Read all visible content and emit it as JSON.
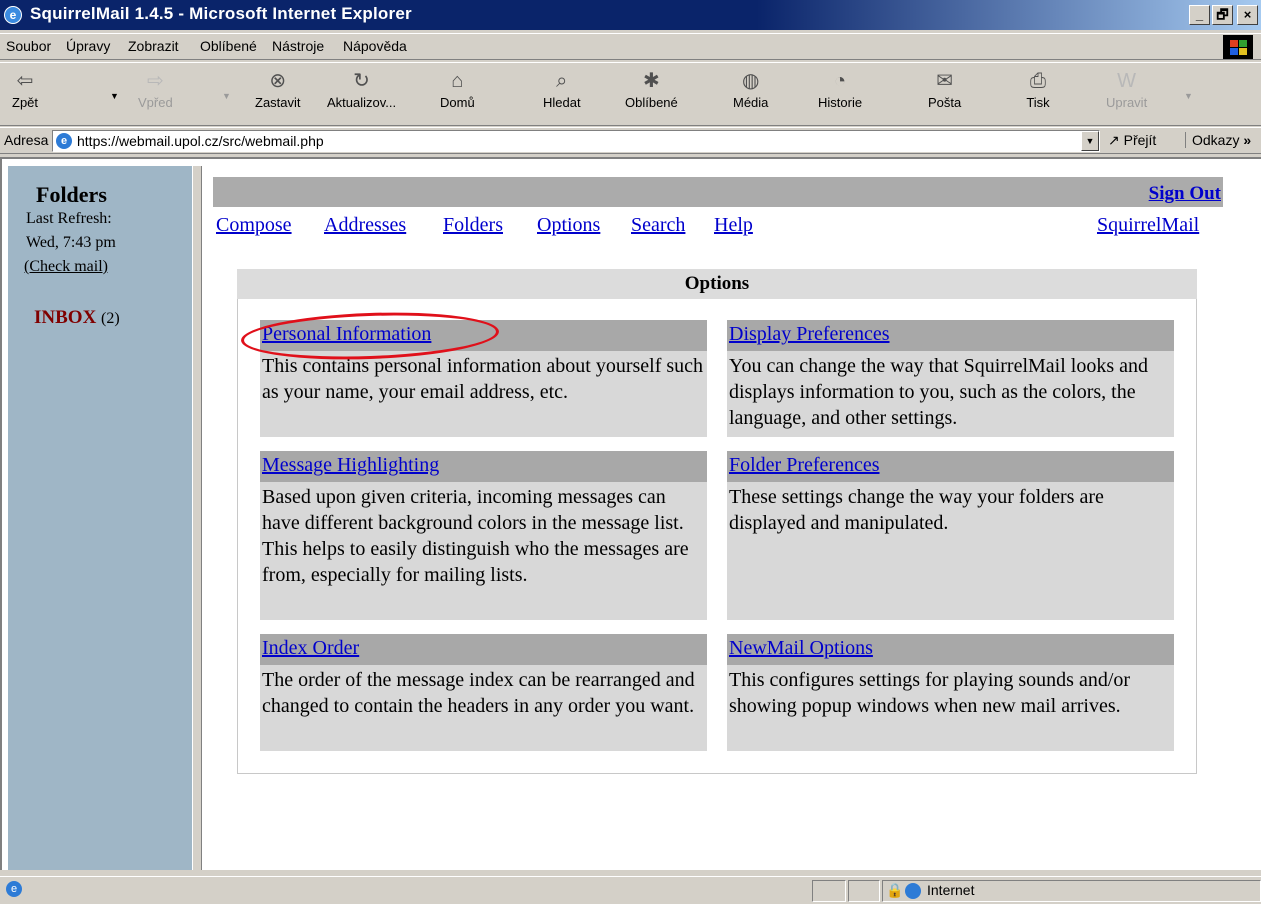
{
  "window": {
    "title": "SquirrelMail 1.4.5 - Microsoft Internet Explorer",
    "controls": {
      "minimize": "_",
      "maximize": "🗗",
      "close": "×"
    }
  },
  "menu": [
    "Soubor",
    "Úpravy",
    "Zobrazit",
    "Oblíbené",
    "Nástroje",
    "Nápověda"
  ],
  "toolbar": {
    "back": "Zpět",
    "forward": "Vpřed",
    "stop": "Zastavit",
    "refresh": "Aktualizov...",
    "home": "Domů",
    "search": "Hledat",
    "favorites": "Oblíbené",
    "media": "Média",
    "history": "Historie",
    "mail": "Pošta",
    "print": "Tisk",
    "edit": "Upravit"
  },
  "address": {
    "label": "Adresa",
    "url": "https://webmail.upol.cz/src/webmail.php",
    "go": "Přejít",
    "links": "Odkazy"
  },
  "left_frame": {
    "title": "Folders",
    "last_refresh_label": "Last Refresh:",
    "last_refresh_time": "Wed, 7:43 pm",
    "check_mail": "(Check mail)",
    "inbox_label": "INBOX",
    "inbox_count": "(2)"
  },
  "right_frame": {
    "sign_out": "Sign Out",
    "nav": [
      "Compose",
      "Addresses",
      "Folders",
      "Options",
      "Search",
      "Help"
    ],
    "brand_link": "SquirrelMail",
    "options_title": "Options",
    "options": [
      {
        "title": "Personal Information",
        "desc": "This contains personal information about yourself such as your name, your email address, etc."
      },
      {
        "title": "Display Preferences",
        "desc": "You can change the way that SquirrelMail looks and displays information to you, such as the colors, the language, and other settings."
      },
      {
        "title": "Message Highlighting",
        "desc": "Based upon given criteria, incoming messages can have different background colors in the message list. This helps to easily distinguish who the messages are from, especially for mailing lists."
      },
      {
        "title": "Folder Preferences",
        "desc": "These settings change the way your folders are displayed and manipulated."
      },
      {
        "title": "Index Order",
        "desc": "The order of the message index can be rearranged and changed to contain the headers in any order you want."
      },
      {
        "title": "NewMail Options",
        "desc": "This configures settings for playing sounds and/or showing popup windows when new mail arrives."
      }
    ]
  },
  "status_bar": {
    "zone": "Internet"
  },
  "colors": {
    "link": "#0000cc",
    "annotation": "#e0101a",
    "left_frame_bg": "#9fb6c6"
  }
}
